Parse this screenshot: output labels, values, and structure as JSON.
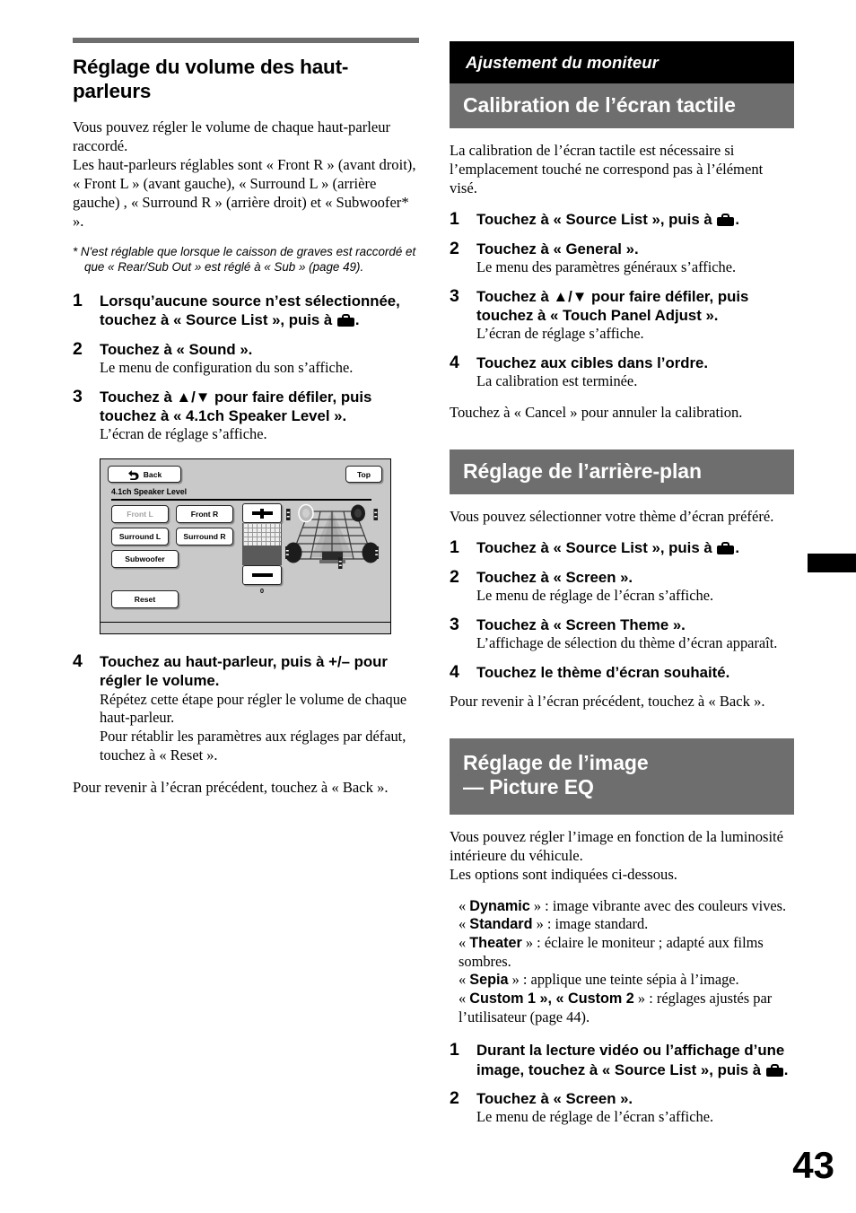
{
  "page": {
    "number": "43"
  },
  "left_column": {
    "heading": "Réglage du volume des haut-parleurs",
    "intro_1": "Vous pouvez régler le volume de chaque haut-parleur raccordé.",
    "intro_2": "Les haut-parleurs réglables sont « Front R » (avant droit), « Front L » (avant gauche), « Surround L » (arrière gauche) , « Surround R » (arrière droit) et « Subwoofer* ».",
    "footnote": "* N'est réglable que lorsque le caisson de graves est raccordé et que « Rear/Sub Out » est réglé à « Sub » (page 49).",
    "steps": [
      {
        "num": "1",
        "head_a": "Lorsqu’aucune source n’est sélectionnée, touchez à « Source List », puis à ",
        "head_b": ".",
        "sub": ""
      },
      {
        "num": "2",
        "head_a": "Touchez à « Sound ».",
        "head_b": "",
        "sub": "Le menu de configuration du son s’affiche."
      },
      {
        "num": "3",
        "head_a": "Touchez à ▲/▼ pour faire défiler, puis touchez à « 4.1ch Speaker Level ».",
        "head_b": "",
        "sub": "L’écran de réglage s’affiche."
      },
      {
        "num": "4",
        "head_a": "Touchez au haut-parleur, puis à +/– pour régler le volume.",
        "head_b": "",
        "sub": "Répétez cette étape pour régler le volume de chaque haut-parleur.\nPour rétablir les paramètres aux réglages par défaut, touchez à « Reset »."
      }
    ],
    "outro": "Pour revenir à l’écran précédent, touchez à « Back »."
  },
  "screen_illustration": {
    "back_button": "Back",
    "top_button": "Top",
    "title": "4.1ch Speaker Level",
    "speaker_buttons": [
      {
        "label": "Front L",
        "disabled": true
      },
      {
        "label": "Front R",
        "disabled": false
      },
      {
        "label": "Surround L",
        "disabled": false
      },
      {
        "label": "Surround R",
        "disabled": false
      },
      {
        "label": "Subwoofer",
        "disabled": false
      }
    ],
    "reset_button": "Reset",
    "level_value": "0",
    "plus_icon": "plus-icon",
    "minus_icon": "minus-icon"
  },
  "right_column": {
    "chapter_banner": "Ajustement du moniteur",
    "section_1": {
      "title": "Calibration de l’écran tactile",
      "intro": "La calibration de l’écran tactile est nécessaire si l’emplacement touché ne correspond pas à l’élément visé.",
      "steps": [
        {
          "num": "1",
          "head_a": "Touchez à « Source List », puis à ",
          "head_b": ".",
          "sub": ""
        },
        {
          "num": "2",
          "head_a": "Touchez à « General ».",
          "head_b": "",
          "sub": "Le menu des paramètres généraux s’affiche."
        },
        {
          "num": "3",
          "head_a": "Touchez à ▲/▼ pour faire défiler, puis touchez à « Touch Panel Adjust ».",
          "head_b": "",
          "sub": "L’écran de réglage s’affiche."
        },
        {
          "num": "4",
          "head_a": "Touchez aux cibles dans l’ordre.",
          "head_b": "",
          "sub": "La calibration est terminée."
        }
      ],
      "outro": "Touchez à « Cancel » pour annuler la calibration."
    },
    "section_2": {
      "title": "Réglage de l’arrière-plan",
      "intro": "Vous pouvez sélectionner votre thème d’écran préféré.",
      "steps": [
        {
          "num": "1",
          "head_a": "Touchez à « Source List », puis à ",
          "head_b": ".",
          "sub": ""
        },
        {
          "num": "2",
          "head_a": "Touchez à « Screen ».",
          "head_b": "",
          "sub": "Le menu de réglage de l’écran s’affiche."
        },
        {
          "num": "3",
          "head_a": "Touchez à « Screen Theme ».",
          "head_b": "",
          "sub": "L’affichage de sélection du thème d’écran apparaît."
        },
        {
          "num": "4",
          "head_a": "Touchez le thème d’écran souhaité.",
          "head_b": "",
          "sub": ""
        }
      ],
      "outro": "Pour revenir à l’écran précédent, touchez à « Back »."
    },
    "section_3": {
      "title_line1": "Réglage de l’image",
      "title_line2": "— Picture EQ",
      "intro": "Vous pouvez régler l’image en fonction de la luminosité intérieure du véhicule.\nLes options sont indiquées ci-dessous.",
      "options": [
        {
          "name": "Dynamic",
          "desc": " : image vibrante avec des couleurs vives."
        },
        {
          "name": "Standard",
          "desc": " : image standard."
        },
        {
          "name": "Theater",
          "desc": " : éclaire le moniteur ; adapté aux films sombres."
        },
        {
          "name": "Sepia",
          "desc": " : applique une teinte sépia à l’image."
        },
        {
          "name": "Custom 1 », « Custom 2",
          "desc": " : réglages ajustés par l’utilisateur (page 44)."
        }
      ],
      "steps": [
        {
          "num": "1",
          "head_a": "Durant la lecture vidéo ou l’affichage d’une image, touchez à « Source List », puis à ",
          "head_b": ".",
          "sub": ""
        },
        {
          "num": "2",
          "head_a": "Touchez à « Screen ».",
          "head_b": "",
          "sub": "Le menu de réglage de l’écran s’affiche."
        }
      ]
    }
  },
  "colors": {
    "banner_black": "#000000",
    "banner_gray": "#6e6e6e",
    "rule_gray": "#6e6e6e",
    "screen_bg": "#c9c9c9"
  }
}
